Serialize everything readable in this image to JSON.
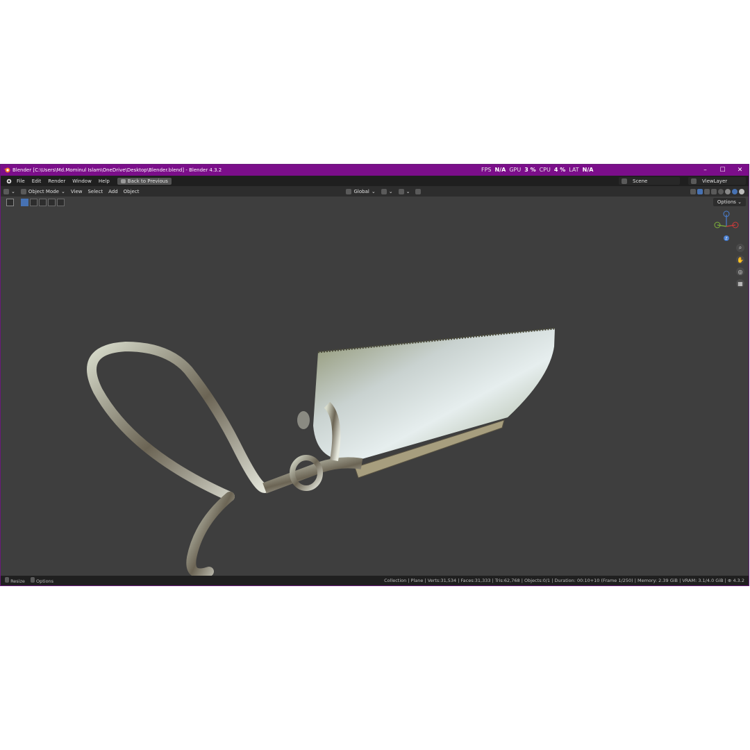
{
  "window": {
    "title": "Blender [C:\\Users\\Md.Mominul Islam\\OneDrive\\Desktop\\Blender.blend] - Blender 4.3.2",
    "controls": [
      "–",
      "☐",
      "✕"
    ],
    "accent": "#7b0e8a"
  },
  "menubar": {
    "items": [
      "File",
      "Edit",
      "Render",
      "Window",
      "Help"
    ],
    "back_label": "Back to Previous"
  },
  "stats": {
    "fps_label": "FPS",
    "fps_value": "N/A",
    "gpu_label": "GPU",
    "gpu_value": "3 %",
    "cpu_label": "CPU",
    "cpu_value": "4 %",
    "lat_label": "LAT",
    "lat_value": "N/A"
  },
  "scene": {
    "label": "Scene",
    "viewlayer": "ViewLayer"
  },
  "header": {
    "mode": "Object Mode",
    "menus": [
      "View",
      "Select",
      "Add",
      "Object"
    ],
    "orientation": "Global"
  },
  "viewport": {
    "options_label": "Options",
    "gizmo_axes": [
      "Z",
      "X",
      "Y"
    ],
    "nav_icons": [
      "zoom-icon",
      "pan-hand-icon",
      "camera-icon",
      "grid-perspective-icon"
    ]
  },
  "statusbar": {
    "resize_label": "Resize",
    "options_label": "Options",
    "info": "Collection | Plane | Verts:31,534 | Faces:31,333 | Tris:62,768 | Objects:0/1 | Duration: 00:10+10 (Frame 1/250) | Memory: 2.39 GiB | VRAM: 3.1/4.0 GiB |",
    "version": "4.3.2"
  }
}
